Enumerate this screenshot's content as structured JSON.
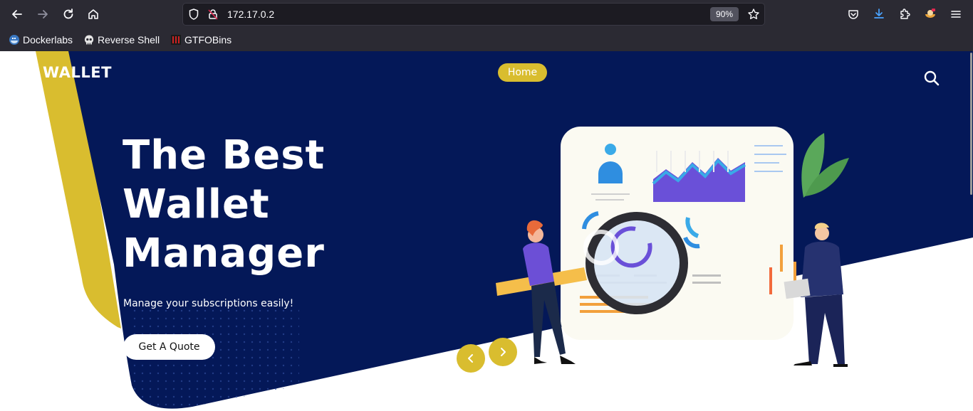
{
  "browser": {
    "url": "172.17.0.2",
    "zoom": "90%",
    "bookmarks": [
      {
        "label": "Dockerlabs",
        "icon": "dockerlabs-icon"
      },
      {
        "label": "Reverse Shell",
        "icon": "skull-icon"
      },
      {
        "label": "GTFOBins",
        "icon": "gtfobins-icon"
      }
    ]
  },
  "site": {
    "brand": "WALLET",
    "nav": {
      "home_label": "Home"
    },
    "hero": {
      "title_lines": [
        "The Best",
        "Wallet",
        "Manager"
      ],
      "subtitle": "Manage your subscriptions easily!",
      "cta_label": "Get A Quote"
    }
  },
  "colors": {
    "navy": "#041858",
    "accent": "#d9bd2f",
    "chrome_bg": "#2b2a33"
  }
}
